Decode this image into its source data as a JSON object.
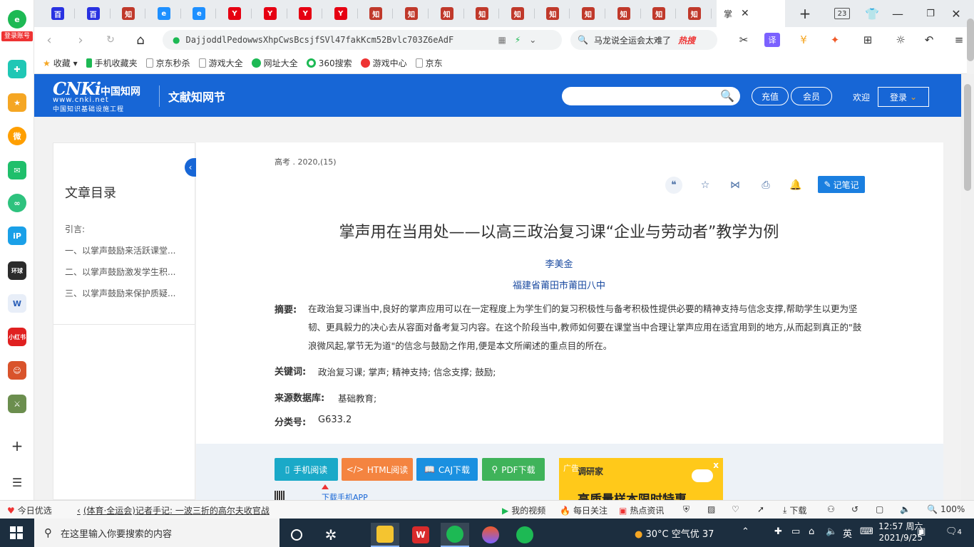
{
  "browser": {
    "login_badge": "登录账号",
    "tabs": [
      {
        "icon": "baidu-paw-icon",
        "label": "百",
        "color": "#2932e1"
      },
      {
        "icon": "baidu-paw-icon",
        "label": "百",
        "color": "#2932e1"
      },
      {
        "icon": "zhi-icon",
        "label": "知",
        "color": "#c0392b"
      },
      {
        "icon": "ie-icon",
        "label": "e",
        "color": "#1e90ff"
      },
      {
        "icon": "ie-icon",
        "label": "e",
        "color": "#1e90ff"
      },
      {
        "icon": "y-icon",
        "label": "Y",
        "color": "#e60012"
      },
      {
        "icon": "y-icon",
        "label": "Y",
        "color": "#e60012"
      },
      {
        "icon": "y-icon",
        "label": "Y",
        "color": "#e60012"
      },
      {
        "icon": "y-icon",
        "label": "Y",
        "color": "#e60012"
      },
      {
        "icon": "zhi-icon",
        "label": "知",
        "color": "#c0392b"
      },
      {
        "icon": "zhi-icon",
        "label": "知",
        "color": "#c0392b"
      },
      {
        "icon": "zhi-icon",
        "label": "知",
        "color": "#c0392b"
      },
      {
        "icon": "zhi-icon",
        "label": "知",
        "color": "#c0392b"
      },
      {
        "icon": "zhi-icon",
        "label": "知",
        "color": "#c0392b"
      },
      {
        "icon": "zhi-icon",
        "label": "知",
        "color": "#c0392b"
      },
      {
        "icon": "zhi-icon",
        "label": "知",
        "color": "#c0392b"
      },
      {
        "icon": "zhi-icon",
        "label": "知",
        "color": "#c0392b"
      },
      {
        "icon": "zhi-icon",
        "label": "知",
        "color": "#c0392b"
      },
      {
        "icon": "zhi-icon",
        "label": "知",
        "color": "#c0392b"
      }
    ],
    "active_tab_label": "掌",
    "tab_count": "23",
    "url": "DajjoddlPedowwsXhpCwsBcsjfSVl47fakKcm52Bvlc703Z6eAdF",
    "search_text": "马龙说全运会太难了",
    "search_badge": "热搜",
    "bookmarks": [
      "收藏",
      "手机收藏夹",
      "京东秒杀",
      "游戏大全",
      "网址大全",
      "360搜索",
      "游戏中心",
      "京东"
    ]
  },
  "cnki": {
    "logo_big": "CNKi",
    "logo_cn": "中国知网",
    "logo_url": "www.cnki.net",
    "logo_sub": "中国知识基础设施工程",
    "section": "文献知网节",
    "recharge": "充值",
    "member": "会员",
    "welcome": "欢迎",
    "login": "登录"
  },
  "toc": {
    "title": "文章目录",
    "items": [
      "引言:",
      "一、以掌声鼓励来活跃课堂...",
      "二、以掌声鼓励激发学生积...",
      "三、以掌声鼓励来保护质疑..."
    ]
  },
  "article": {
    "journal": "高考 . 2020,(15)",
    "note_button": "记笔记",
    "title": "掌声用在当用处——以高三政治复习课“企业与劳动者”教学为例",
    "author": "李美金",
    "org": "福建省莆田市莆田八中",
    "abstract_label": "摘要:",
    "abstract": "在政治复习课当中,良好的掌声应用可以在一定程度上为学生们的复习积极性与备考积极性提供必要的精神支持与信念支撑,帮助学生以更为坚韧、更具毅力的决心去从容面对备考复习内容。在这个阶段当中,教师如何要在课堂当中合理让掌声应用在适宜用到的地方,从而起到真正的\"鼓浪微风起,掌节无为道\"的信念与鼓励之作用,便是本文所阐述的重点目的所在。",
    "keywords_label": "关键词:",
    "keywords": "政治复习课;  掌声;  精神支持;  信念支撑;  鼓励;",
    "source_label": "来源数据库:",
    "source": "基础教育;",
    "class_label": "分类号:",
    "class": "G633.2"
  },
  "downloads": {
    "mobile": "手机阅读",
    "html": "HTML阅读",
    "caj": "CAJ下载",
    "pdf": "PDF下载",
    "app": "下载手机APP"
  },
  "ad": {
    "tag": "广告",
    "brand": "调研家",
    "close": "x",
    "text": "高质量样本限时特惠"
  },
  "statusbar": {
    "today": "今日优选",
    "news": "(体育·全运会)记者手记: 一波三折的高尔夫收官战",
    "video": "我的视频",
    "daily": "每日关注",
    "hot": "热点资讯",
    "download": "下载",
    "zoom": "100%"
  },
  "taskbar": {
    "search_placeholder": "在这里输入你要搜索的内容",
    "weather": "30°C  空气优 37",
    "lang": "英",
    "time": "12:57 周六",
    "date": "2021/9/25",
    "notif_count": "4"
  }
}
